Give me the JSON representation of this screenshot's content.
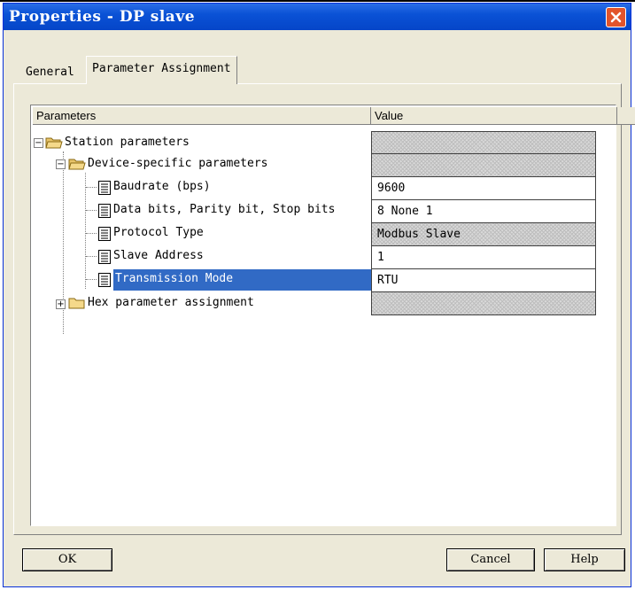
{
  "window": {
    "title": "Properties - DP slave"
  },
  "tabs": [
    {
      "label": "General",
      "active": false
    },
    {
      "label": "Parameter Assignment",
      "active": true
    }
  ],
  "grid": {
    "columns": [
      "Parameters",
      "Value"
    ],
    "rows": [
      {
        "label": "Station parameters",
        "value": "",
        "expander": "−",
        "icon": "folder-open-icon"
      },
      {
        "label": "Device-specific parameters",
        "value": "",
        "expander": "−",
        "icon": "folder-open-icon"
      },
      {
        "label": "Baudrate (bps)",
        "value": "9600",
        "icon": "document-icon"
      },
      {
        "label": "Data bits, Parity bit, Stop bits",
        "value": "8 None 1",
        "icon": "document-icon"
      },
      {
        "label": "Protocol Type",
        "value": "Modbus Slave",
        "icon": "document-icon"
      },
      {
        "label": "Slave Address",
        "value": "1",
        "icon": "document-icon"
      },
      {
        "label": "Transmission Mode",
        "value": "RTU",
        "icon": "document-icon",
        "selected": true
      },
      {
        "label": "Hex parameter assignment",
        "value": "",
        "expander": "+",
        "icon": "folder-closed-icon"
      }
    ]
  },
  "buttons": {
    "ok": "OK",
    "cancel": "Cancel",
    "help": "Help"
  },
  "colors": {
    "titlebar": "#0a52d6",
    "selection": "#316ac5",
    "dialog_bg": "#ece9d8",
    "close": "#e2542b"
  }
}
